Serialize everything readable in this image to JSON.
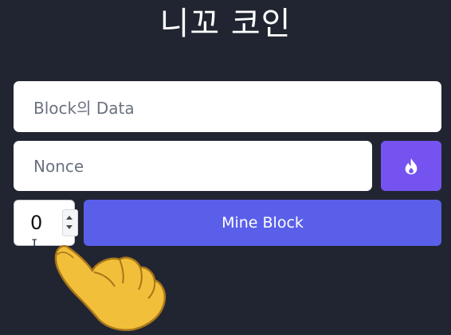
{
  "app": {
    "title": "니꼬 코인"
  },
  "form": {
    "data_placeholder": "Block의 Data",
    "nonce_placeholder": "Nonce",
    "fire_icon": "fire-icon",
    "stepper_value": "0",
    "mine_label": "Mine Block"
  },
  "colors": {
    "background": "#212531",
    "fire_button": "#7553f0",
    "mine_button": "#5a5fea",
    "field": "#ffffff"
  },
  "overlay": {
    "pointer": "pointing-hand-emoji",
    "cursor": "text-cursor"
  }
}
